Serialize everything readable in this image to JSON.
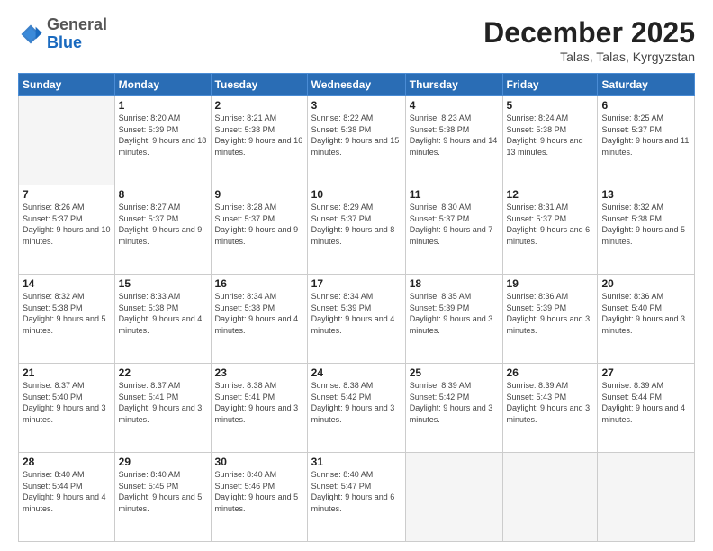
{
  "logo": {
    "general": "General",
    "blue": "Blue"
  },
  "header": {
    "month": "December 2025",
    "location": "Talas, Talas, Kyrgyzstan"
  },
  "weekdays": [
    "Sunday",
    "Monday",
    "Tuesday",
    "Wednesday",
    "Thursday",
    "Friday",
    "Saturday"
  ],
  "weeks": [
    [
      {
        "day": "",
        "empty": true
      },
      {
        "day": "1",
        "sunrise": "8:20 AM",
        "sunset": "5:39 PM",
        "daylight": "9 hours and 18 minutes."
      },
      {
        "day": "2",
        "sunrise": "8:21 AM",
        "sunset": "5:38 PM",
        "daylight": "9 hours and 16 minutes."
      },
      {
        "day": "3",
        "sunrise": "8:22 AM",
        "sunset": "5:38 PM",
        "daylight": "9 hours and 15 minutes."
      },
      {
        "day": "4",
        "sunrise": "8:23 AM",
        "sunset": "5:38 PM",
        "daylight": "9 hours and 14 minutes."
      },
      {
        "day": "5",
        "sunrise": "8:24 AM",
        "sunset": "5:38 PM",
        "daylight": "9 hours and 13 minutes."
      },
      {
        "day": "6",
        "sunrise": "8:25 AM",
        "sunset": "5:37 PM",
        "daylight": "9 hours and 11 minutes."
      }
    ],
    [
      {
        "day": "7",
        "sunrise": "8:26 AM",
        "sunset": "5:37 PM",
        "daylight": "9 hours and 10 minutes."
      },
      {
        "day": "8",
        "sunrise": "8:27 AM",
        "sunset": "5:37 PM",
        "daylight": "9 hours and 9 minutes."
      },
      {
        "day": "9",
        "sunrise": "8:28 AM",
        "sunset": "5:37 PM",
        "daylight": "9 hours and 9 minutes."
      },
      {
        "day": "10",
        "sunrise": "8:29 AM",
        "sunset": "5:37 PM",
        "daylight": "9 hours and 8 minutes."
      },
      {
        "day": "11",
        "sunrise": "8:30 AM",
        "sunset": "5:37 PM",
        "daylight": "9 hours and 7 minutes."
      },
      {
        "day": "12",
        "sunrise": "8:31 AM",
        "sunset": "5:37 PM",
        "daylight": "9 hours and 6 minutes."
      },
      {
        "day": "13",
        "sunrise": "8:32 AM",
        "sunset": "5:38 PM",
        "daylight": "9 hours and 5 minutes."
      }
    ],
    [
      {
        "day": "14",
        "sunrise": "8:32 AM",
        "sunset": "5:38 PM",
        "daylight": "9 hours and 5 minutes."
      },
      {
        "day": "15",
        "sunrise": "8:33 AM",
        "sunset": "5:38 PM",
        "daylight": "9 hours and 4 minutes."
      },
      {
        "day": "16",
        "sunrise": "8:34 AM",
        "sunset": "5:38 PM",
        "daylight": "9 hours and 4 minutes."
      },
      {
        "day": "17",
        "sunrise": "8:34 AM",
        "sunset": "5:39 PM",
        "daylight": "9 hours and 4 minutes."
      },
      {
        "day": "18",
        "sunrise": "8:35 AM",
        "sunset": "5:39 PM",
        "daylight": "9 hours and 3 minutes."
      },
      {
        "day": "19",
        "sunrise": "8:36 AM",
        "sunset": "5:39 PM",
        "daylight": "9 hours and 3 minutes."
      },
      {
        "day": "20",
        "sunrise": "8:36 AM",
        "sunset": "5:40 PM",
        "daylight": "9 hours and 3 minutes."
      }
    ],
    [
      {
        "day": "21",
        "sunrise": "8:37 AM",
        "sunset": "5:40 PM",
        "daylight": "9 hours and 3 minutes."
      },
      {
        "day": "22",
        "sunrise": "8:37 AM",
        "sunset": "5:41 PM",
        "daylight": "9 hours and 3 minutes."
      },
      {
        "day": "23",
        "sunrise": "8:38 AM",
        "sunset": "5:41 PM",
        "daylight": "9 hours and 3 minutes."
      },
      {
        "day": "24",
        "sunrise": "8:38 AM",
        "sunset": "5:42 PM",
        "daylight": "9 hours and 3 minutes."
      },
      {
        "day": "25",
        "sunrise": "8:39 AM",
        "sunset": "5:42 PM",
        "daylight": "9 hours and 3 minutes."
      },
      {
        "day": "26",
        "sunrise": "8:39 AM",
        "sunset": "5:43 PM",
        "daylight": "9 hours and 3 minutes."
      },
      {
        "day": "27",
        "sunrise": "8:39 AM",
        "sunset": "5:44 PM",
        "daylight": "9 hours and 4 minutes."
      }
    ],
    [
      {
        "day": "28",
        "sunrise": "8:40 AM",
        "sunset": "5:44 PM",
        "daylight": "9 hours and 4 minutes."
      },
      {
        "day": "29",
        "sunrise": "8:40 AM",
        "sunset": "5:45 PM",
        "daylight": "9 hours and 5 minutes."
      },
      {
        "day": "30",
        "sunrise": "8:40 AM",
        "sunset": "5:46 PM",
        "daylight": "9 hours and 5 minutes."
      },
      {
        "day": "31",
        "sunrise": "8:40 AM",
        "sunset": "5:47 PM",
        "daylight": "9 hours and 6 minutes."
      },
      {
        "day": "",
        "empty": true
      },
      {
        "day": "",
        "empty": true
      },
      {
        "day": "",
        "empty": true
      }
    ]
  ]
}
